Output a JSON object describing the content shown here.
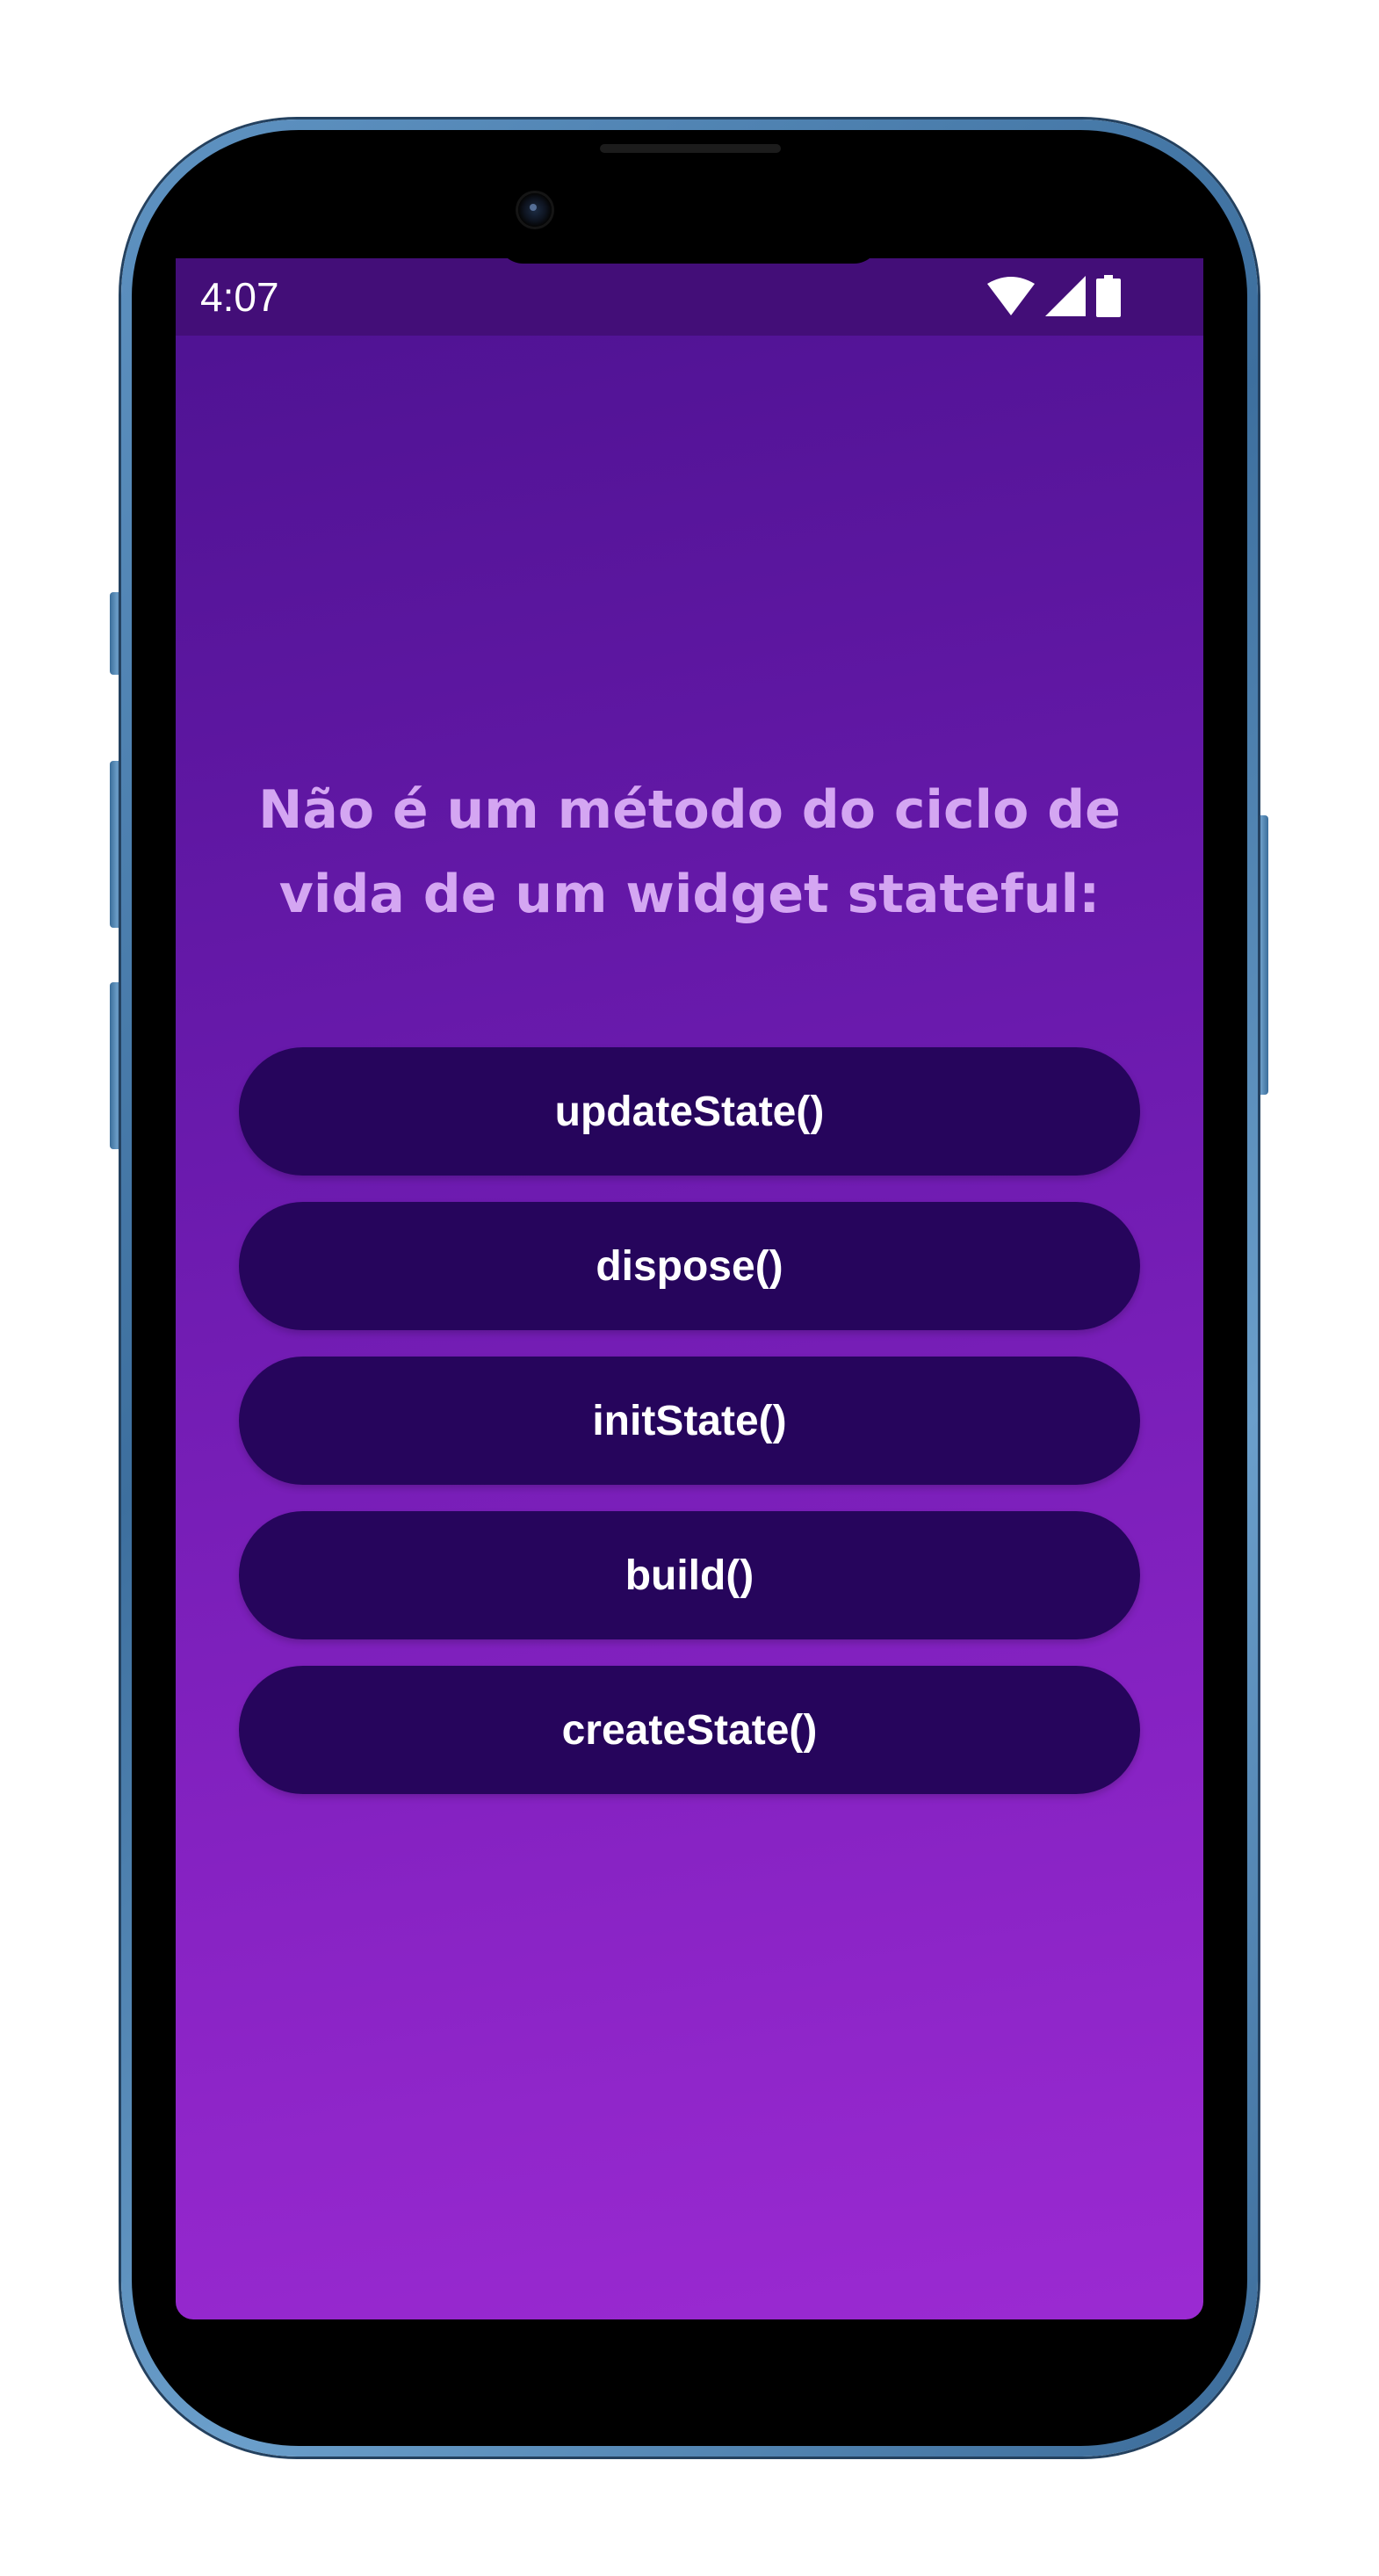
{
  "status_bar": {
    "time": "4:07",
    "icons": [
      "wifi-icon",
      "signal-icon",
      "battery-icon"
    ]
  },
  "quiz": {
    "question": "Não é um método do ciclo de vida de um widget stateful:",
    "answers": [
      {
        "label": "updateState()"
      },
      {
        "label": "dispose()"
      },
      {
        "label": "initState()"
      },
      {
        "label": "build()"
      },
      {
        "label": "createState()"
      }
    ]
  },
  "colors": {
    "background_top": "#4d1291",
    "background_bottom": "#9b2ad2",
    "status_bar": "#430e78",
    "question_text": "#d4a6f2",
    "answer_button": "#26055c",
    "answer_text": "#ffffff",
    "phone_frame": "#4f82b1"
  }
}
